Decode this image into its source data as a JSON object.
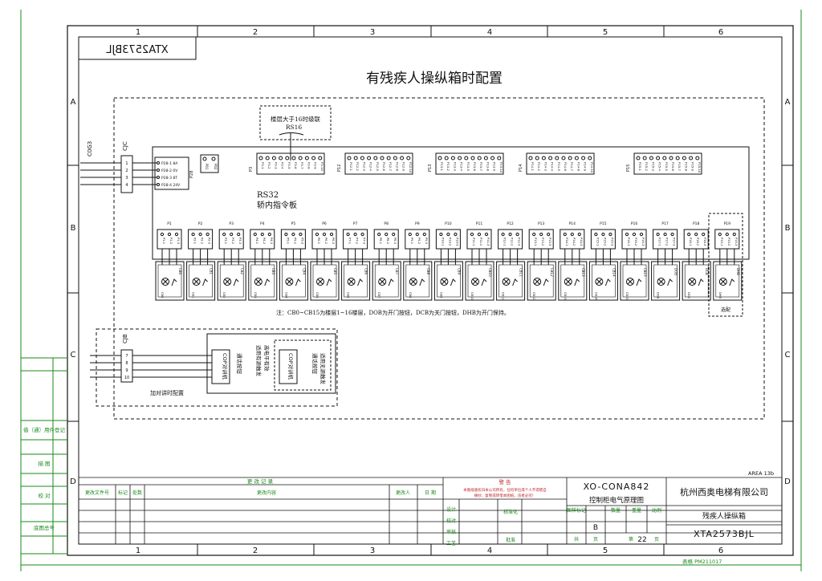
{
  "sheet": {
    "title": "有残疾人操纵箱时配置",
    "mirrored_code": "XTA2573BJL",
    "area": "AREA 13b",
    "form_no": "表格 PM211017",
    "col_labels": [
      "1",
      "2",
      "3",
      "4",
      "5",
      "6"
    ],
    "row_labels": [
      "A",
      "B",
      "C",
      "D"
    ]
  },
  "board": {
    "name": "RS32",
    "desc": "轿内指令板",
    "rs16_note_line1": "楼层大于16时级联",
    "rs16_note_line2": "RS16",
    "cjc_label": "CJC",
    "cjb_label": "CJB",
    "cable_label": "C0G3",
    "p28_label": "P28",
    "p28_pins": [
      "P28-1 8A",
      "P28-2 0V",
      "P28-3 8T",
      "P28-4 24V"
    ],
    "jumpers": [
      "P01",
      "P02"
    ],
    "connectors": [
      {
        "name": "P3",
        "pins": [
          "P3-1",
          "P3-2",
          "P3-3",
          "P3-4",
          "P3-5",
          "P3-6",
          "P3-7",
          "P3-8",
          "P3-9",
          "P3-10"
        ]
      },
      {
        "name": "P12",
        "pins": [
          "P12-1",
          "P12-2",
          "P12-3",
          "P12-4",
          "P12-5",
          "P12-6",
          "P12-7",
          "P12-8",
          "P12-9",
          "P12-10"
        ]
      },
      {
        "name": "P13",
        "pins": [
          "P13-1",
          "P13-2",
          "P13-3",
          "P13-4",
          "P13-5",
          "P13-6",
          "P13-7",
          "P13-8",
          "P13-9",
          "P13-10"
        ]
      },
      {
        "name": "P14",
        "pins": [
          "P14-1",
          "P14-2",
          "P14-3",
          "P14-4",
          "P14-5",
          "P14-6",
          "P14-7",
          "P14-8",
          "P14-9",
          "P14-10"
        ]
      },
      {
        "name": "P15",
        "pins": [
          "P15-1",
          "P15-2",
          "P15-3",
          "P15-4",
          "P15-5",
          "P15-6",
          "P15-7",
          "P15-8",
          "P15-9",
          "P15-10"
        ]
      }
    ],
    "buttons": [
      {
        "conn": "P1",
        "btn": "CB0"
      },
      {
        "conn": "P2",
        "btn": "CB1"
      },
      {
        "conn": "P3",
        "btn": "CB2"
      },
      {
        "conn": "P4",
        "btn": "CB3"
      },
      {
        "conn": "P5",
        "btn": "CB4"
      },
      {
        "conn": "P6",
        "btn": "CB5"
      },
      {
        "conn": "P7",
        "btn": "CB6"
      },
      {
        "conn": "P8",
        "btn": "CB7"
      },
      {
        "conn": "P9",
        "btn": "CB8"
      },
      {
        "conn": "P10",
        "btn": "CB9"
      },
      {
        "conn": "P11",
        "btn": "CB10"
      },
      {
        "conn": "P12",
        "btn": "CB11"
      },
      {
        "conn": "P13",
        "btn": "CB12"
      },
      {
        "conn": "P14",
        "btn": "CB13"
      },
      {
        "conn": "P15",
        "btn": "CB14"
      },
      {
        "conn": "P16",
        "btn": "CB15"
      },
      {
        "conn": "P17",
        "btn": "DOB"
      },
      {
        "conn": "P18",
        "btn": "DCB"
      }
    ],
    "optional_button": {
      "conn": "P19",
      "btn": "DHB",
      "label": "选配"
    },
    "note": "注：CB0~CB15为楼层1~16楼层，DOB为开门按钮，DCB为关门按钮，DHB为开门保持。"
  },
  "intercom": {
    "cjb_pins": [
      "7",
      "8",
      "9",
      "10"
    ],
    "device_label": "COP对讲机",
    "button_label": "通话按钮",
    "mode_text_line1": "适用有源触发",
    "mode_text_line2": "高电平有效",
    "alt_label_line1": "通话按钮",
    "alt_label_line2": "适用无源触发",
    "caption": "加对讲时配置"
  },
  "title_block": {
    "revision_header": "更 改 记 录",
    "rev_cols": [
      "更改文件号",
      "标记",
      "处数",
      "更改内容",
      "更改人",
      "日 期"
    ],
    "warning_title": "警 告",
    "warning_text_1": "本图纸版权归本公司所有，任何单位或个人不得擅自",
    "warning_text_2": "摘抄、复制或转借本图纸，违者必究！",
    "drawing_no": "XO-CONA842",
    "drawing_name": "控制柜电气原理图",
    "company": "杭州西奥电梯有限公司",
    "part_name": "残疾人操纵箱",
    "part_code": "XTA2573BJL",
    "sign_rows": [
      "设计",
      "校对",
      "审核",
      "工艺"
    ],
    "std": "标准化",
    "approve": "批准",
    "stage_header": "图样标记",
    "qty_header": "数量",
    "weight_header": "重量",
    "scale_header": "比例",
    "stage_mark": "B",
    "total_label": "共",
    "sheet_label": "页",
    "page_prefix": "第",
    "page_no": "22",
    "page_suffix": "页"
  },
  "left_strip": [
    "借（通）用件登记",
    "描 图",
    "校 对",
    "底图总号"
  ]
}
